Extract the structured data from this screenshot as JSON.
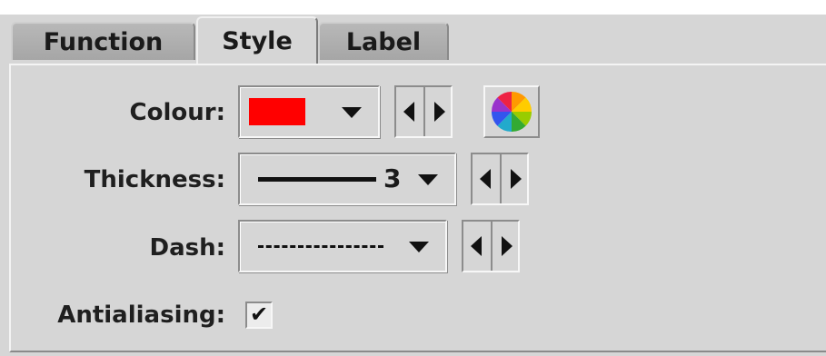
{
  "tabs": [
    {
      "label": "Function",
      "active": false
    },
    {
      "label": "Style",
      "active": true
    },
    {
      "label": "Label",
      "active": false
    }
  ],
  "style": {
    "colour": {
      "label": "Colour:",
      "selected_color": "#ff0000"
    },
    "thickness": {
      "label": "Thickness:",
      "value": "3"
    },
    "dash": {
      "label": "Dash:"
    },
    "antialiasing": {
      "label": "Antialiasing:",
      "checked": true,
      "check_glyph": "✔"
    }
  },
  "colors": {
    "window_bg": "#d6d6d6",
    "tab_inactive": "#a6a6a6"
  },
  "icons": {
    "colour_chooser": "color-wheel-icon",
    "dropdown": "chevron-down-icon",
    "prev": "triangle-left-icon",
    "next": "triangle-right-icon"
  }
}
